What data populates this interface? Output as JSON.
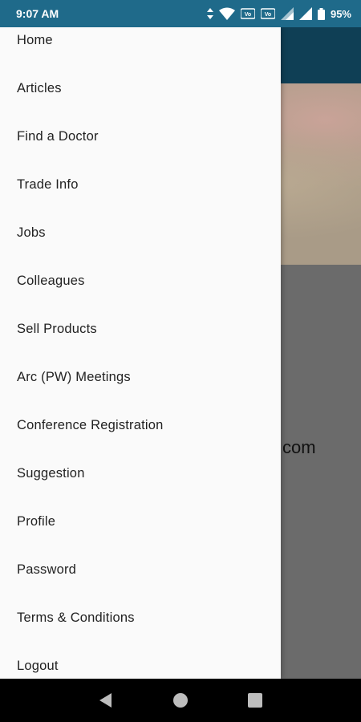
{
  "status_bar": {
    "time": "9:07 AM",
    "battery_percent": "95%",
    "icons": [
      "data-arrows-icon",
      "wifi-icon",
      "volte-icon",
      "volte-icon",
      "signal-icon",
      "signal-icon",
      "battery-icon"
    ]
  },
  "background_app": {
    "partial_text": "com"
  },
  "drawer": {
    "items": [
      {
        "label": "Home"
      },
      {
        "label": "Articles"
      },
      {
        "label": "Find a Doctor"
      },
      {
        "label": "Trade Info"
      },
      {
        "label": "Jobs"
      },
      {
        "label": "Colleagues"
      },
      {
        "label": "Sell Products"
      },
      {
        "label": "Arc (PW) Meetings"
      },
      {
        "label": "Conference Registration"
      },
      {
        "label": "Suggestion"
      },
      {
        "label": "Profile"
      },
      {
        "label": "Password"
      },
      {
        "label": "Terms & Conditions"
      },
      {
        "label": "Logout"
      }
    ]
  },
  "nav_bar": {
    "buttons": [
      "back-icon",
      "home-icon",
      "recents-icon"
    ]
  },
  "colors": {
    "status_bar": "#1f6a8a",
    "toolbar": "#0f3f55",
    "drawer_bg": "#fafafa",
    "scrim": "#6b6b6b"
  }
}
